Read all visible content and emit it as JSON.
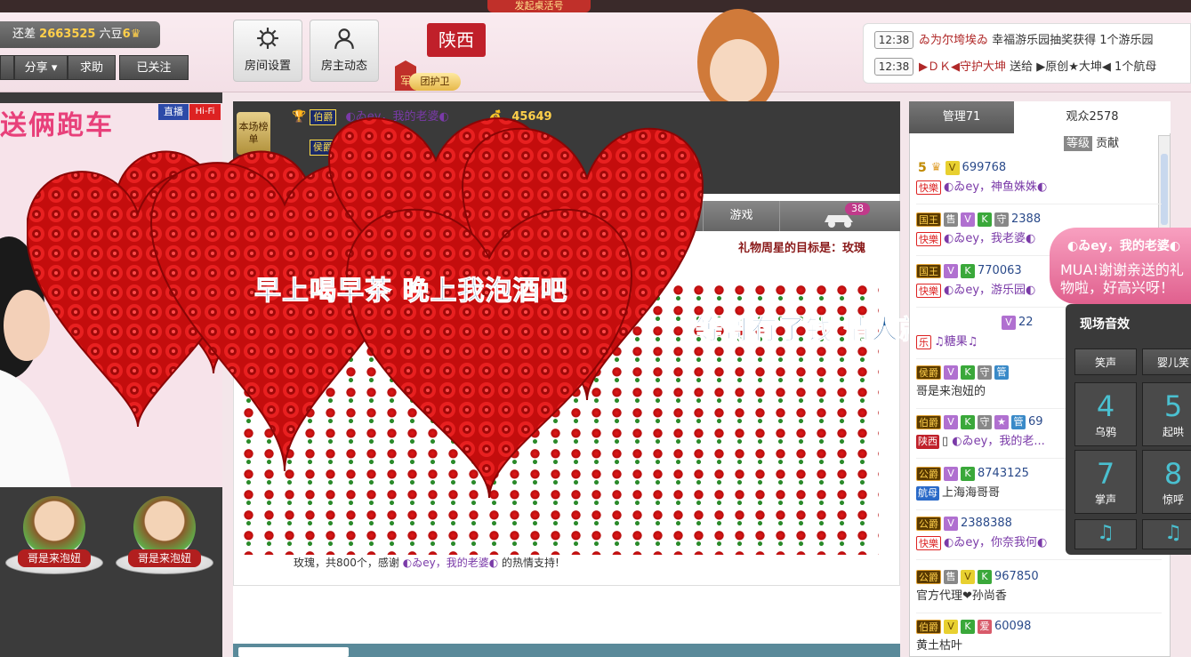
{
  "topbar": {
    "banner": "发起桌活号",
    "rank_prefix": "还差",
    "rank_number": "2663525",
    "rank_level_text": "六豆",
    "rank_crown_level": "6",
    "share_label": "分享",
    "help_label": "求助",
    "follow_label": "已关注",
    "room_settings_label": "房间设置",
    "host_news_label": "房主动态",
    "province": "陕西",
    "guard_badge": "军",
    "guard_label": "团护卫"
  },
  "notices": [
    {
      "time": "12:38",
      "text_a": "ゐ为尔垮埃ゐ",
      "text_b": "幸福游乐园抽奖获得 1个游乐园"
    },
    {
      "time": "12:38",
      "text_a": "▶ＤＫ◀守护大坤",
      "text_b": "送给 ▶原创★大坤◀ 1个航母"
    }
  ],
  "stream": {
    "title": "送俩跑车",
    "live_badge": "直播",
    "hifi_badge": "Hi-Fi"
  },
  "seats": [
    {
      "name": "哥是来泡妞"
    },
    {
      "name": "哥是来泡妞"
    }
  ],
  "ranking": {
    "badge": "本场榜单",
    "rows": [
      {
        "title": "伯爵",
        "name": "◐ゐey，我的老婆◐",
        "gold": "45649"
      },
      {
        "title": "侯爵",
        "name": "",
        "gold": ""
      }
    ]
  },
  "center_tabs": {
    "game_label": "游戏",
    "car_count": "38"
  },
  "weekly_target": "礼物周星的目标是：玫瑰",
  "gift_thanks": {
    "prefix": "玫瑰，共800个，感谢",
    "user": "◐ゐey，我的老婆◐",
    "suffix": "的热情支持!"
  },
  "lyrics": {
    "line1": "早上喝早茶 晚上我泡酒吧",
    "line2": "等哥有了钱 情人就一大把"
  },
  "right_panel": {
    "tab_admin": "管理71",
    "tab_audience": "观众2578",
    "sort_level": "等级",
    "sort_contrib": "贡献",
    "users": [
      {
        "level": "5",
        "uid": "699768",
        "tag": "快樂",
        "name": "◐ゐey，神鱼姝姝◐"
      },
      {
        "title": "国王",
        "uid": "2388",
        "tag": "快樂",
        "name": "◐ゐey，我老婆◐"
      },
      {
        "title": "国王",
        "uid": "770063",
        "tag": "快樂",
        "name": "◐ゐey，游乐园◐"
      },
      {
        "title": "",
        "uid": "22",
        "tag": "乐",
        "name": "♫糖果♫"
      },
      {
        "title": "侯爵",
        "uid": "",
        "name": "哥是来泡妞的"
      },
      {
        "title": "伯爵",
        "uid": "69",
        "tag": "陕西",
        "name": "◐ゐey，我的老..."
      },
      {
        "title": "公爵",
        "uid": "8743125",
        "tag": "航母",
        "name": "上海海哥哥"
      },
      {
        "title": "公爵",
        "uid": "2388388",
        "tag": "快樂",
        "name": "◐ゐey，你奈我何◐"
      },
      {
        "title": "公爵",
        "uid": "967850",
        "name": "官方代理❤孙尚香"
      },
      {
        "title": "伯爵",
        "uid": "60098",
        "name": "黄土枯叶"
      }
    ]
  },
  "bubble": {
    "title": "◐ゐey，我的老婆◐",
    "text": "MUA!谢谢亲送的礼物啦，好高兴呀！"
  },
  "sfx": {
    "title": "现场音效",
    "buttons": [
      "笑声",
      "婴儿笑"
    ],
    "pads": [
      {
        "n": "4",
        "label": "乌鸦"
      },
      {
        "n": "5",
        "label": "起哄"
      },
      {
        "n": "7",
        "label": "掌声"
      },
      {
        "n": "8",
        "label": "惊呼"
      }
    ]
  },
  "colors": {
    "accent": "#c0202a",
    "rose": "#d81818",
    "lyric": "#1a5a9a"
  }
}
